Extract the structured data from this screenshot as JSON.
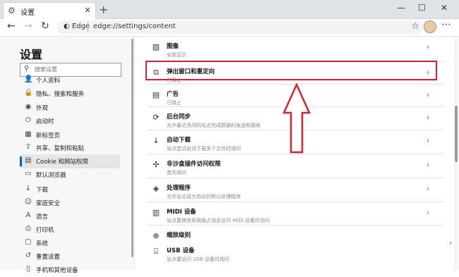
{
  "tab": {
    "label": "设置",
    "close": "×"
  },
  "newtab": "+",
  "window": {
    "min": "—",
    "max": "☐",
    "close": "✕"
  },
  "nav": {
    "back": "←",
    "forward": "→",
    "refresh": "↻",
    "menu": "⋯"
  },
  "address": {
    "site_label": "Edge",
    "url": "edge://settings/content",
    "star": "☆"
  },
  "sidebar": {
    "title": "设置",
    "search_placeholder": "搜索设置",
    "items": [
      {
        "icon": "👤",
        "label": "个人资料"
      },
      {
        "icon": "🔒",
        "label": "隐私、搜索和服务"
      },
      {
        "icon": "◉",
        "label": "外观"
      },
      {
        "icon": "⏻",
        "label": "启动时"
      },
      {
        "icon": "▦",
        "label": "新标签页"
      },
      {
        "icon": "⇪",
        "label": "共享、复制和粘贴"
      },
      {
        "icon": "▤",
        "label": "Cookie 和网站权限"
      },
      {
        "icon": "▭",
        "label": "默认浏览器"
      },
      {
        "icon": "↓",
        "label": "下载"
      },
      {
        "icon": "☺",
        "label": "家庭安全"
      },
      {
        "icon": "A",
        "label": "语言"
      },
      {
        "icon": "⎙",
        "label": "打印机"
      },
      {
        "icon": "▢",
        "label": "系统"
      },
      {
        "icon": "↺",
        "label": "重置设置"
      },
      {
        "icon": "▯",
        "label": "手机和其他设备"
      }
    ],
    "active_index": 6
  },
  "content": {
    "rows": [
      {
        "icon": "▨",
        "title": "图像",
        "sub": "全部显示"
      },
      {
        "icon": "⧉",
        "title": "弹出窗口和重定向",
        "sub": "已阻止"
      },
      {
        "icon": "▤",
        "title": "广告",
        "sub": "已阻止"
      },
      {
        "icon": "⟳",
        "title": "后台同步",
        "sub": "允许最近关闭的站点完成数据的发送和接收"
      },
      {
        "icon": "↓",
        "title": "自动下载",
        "sub": "站点尝试自动下载多个文件时询问"
      },
      {
        "icon": "✣",
        "title": "非沙盒插件访问权限",
        "sub": "首先询问"
      },
      {
        "icon": "◈",
        "title": "处理程序",
        "sub": "允许站点成为协议的默认处理程序"
      },
      {
        "icon": "▥",
        "title": "MIDI 设备",
        "sub": "站点要使用系统独占消息访问 MIDI 设备时询问"
      },
      {
        "icon": "⊕",
        "title": "缩放级别",
        "sub": ""
      },
      {
        "icon": "⌸",
        "title": "USB 设备",
        "sub": "站点要访问 USB 设备时询问"
      }
    ],
    "chevron": "›"
  },
  "colors": {
    "highlight": "#d9242b",
    "accent": "#0067b8"
  }
}
